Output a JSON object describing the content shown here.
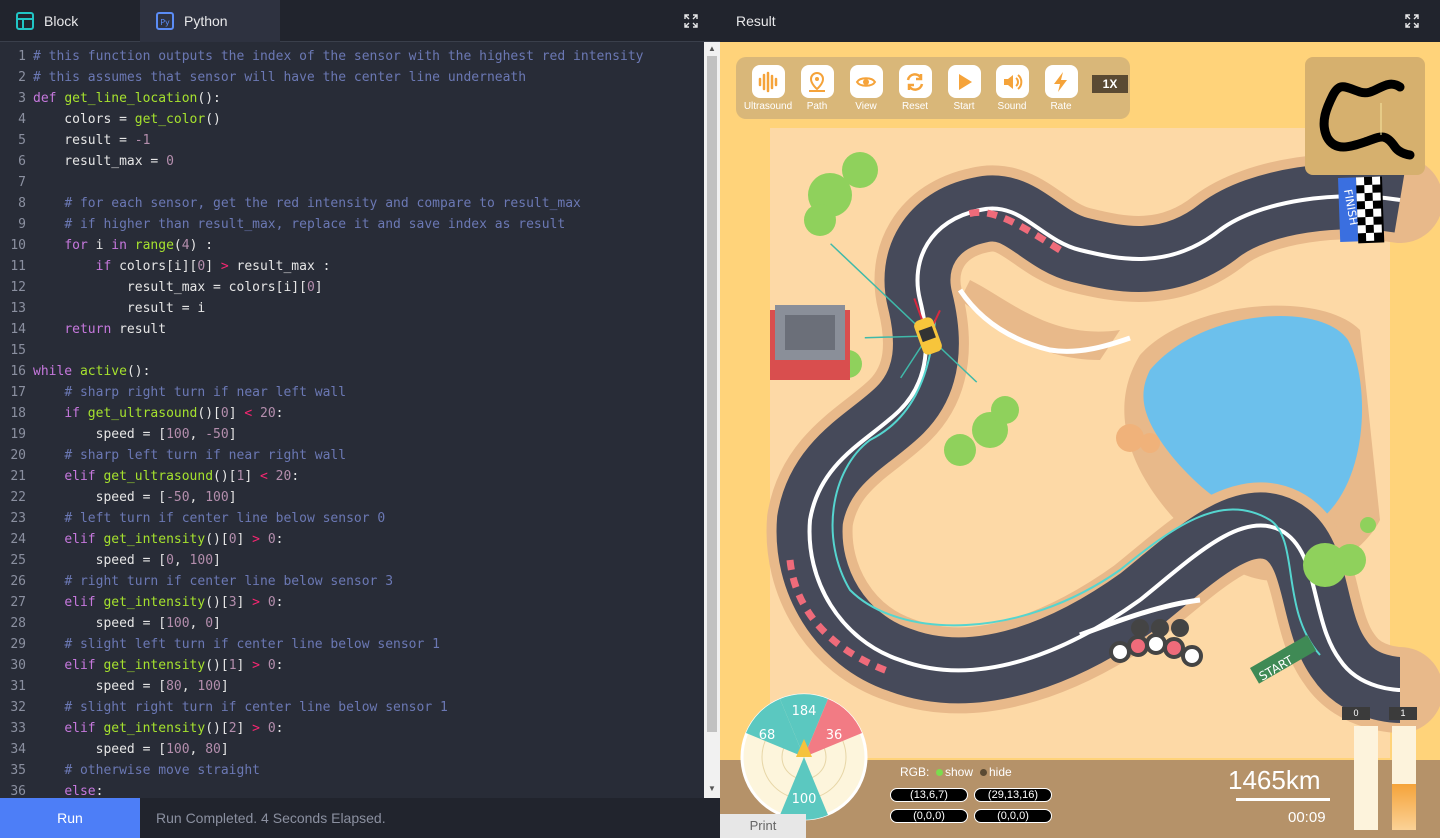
{
  "editor": {
    "tabs": [
      {
        "label": "Block",
        "icon": "block-grid-icon"
      },
      {
        "label": "Python",
        "icon": "python-file-icon"
      }
    ],
    "lines": [
      {
        "n": "1",
        "text": "# this function outputs the index of the sensor with the highest red intensity"
      },
      {
        "n": "2",
        "text": "# this assumes that sensor will have the center line underneath"
      },
      {
        "n": "3",
        "text": "def get_line_location():"
      },
      {
        "n": "4",
        "text": "    colors = get_color()"
      },
      {
        "n": "5",
        "text": "    result = -1"
      },
      {
        "n": "6",
        "text": "    result_max = 0"
      },
      {
        "n": "7",
        "text": ""
      },
      {
        "n": "8",
        "text": "    # for each sensor, get the red intensity and compare to result_max"
      },
      {
        "n": "9",
        "text": "    # if higher than result_max, replace it and save index as result"
      },
      {
        "n": "10",
        "text": "    for i in range(4) :"
      },
      {
        "n": "11",
        "text": "        if colors[i][0] > result_max :"
      },
      {
        "n": "12",
        "text": "            result_max = colors[i][0]"
      },
      {
        "n": "13",
        "text": "            result = i"
      },
      {
        "n": "14",
        "text": "    return result"
      },
      {
        "n": "15",
        "text": ""
      },
      {
        "n": "16",
        "text": "while active():"
      },
      {
        "n": "17",
        "text": "    # sharp right turn if near left wall"
      },
      {
        "n": "18",
        "text": "    if get_ultrasound()[0] < 20:"
      },
      {
        "n": "19",
        "text": "        speed = [100, -50]"
      },
      {
        "n": "20",
        "text": "    # sharp left turn if near right wall"
      },
      {
        "n": "21",
        "text": "    elif get_ultrasound()[1] < 20:"
      },
      {
        "n": "22",
        "text": "        speed = [-50, 100]"
      },
      {
        "n": "23",
        "text": "    # left turn if center line below sensor 0"
      },
      {
        "n": "24",
        "text": "    elif get_intensity()[0] > 0:"
      },
      {
        "n": "25",
        "text": "        speed = [0, 100]"
      },
      {
        "n": "26",
        "text": "    # right turn if center line below sensor 3"
      },
      {
        "n": "27",
        "text": "    elif get_intensity()[3] > 0:"
      },
      {
        "n": "28",
        "text": "        speed = [100, 0]"
      },
      {
        "n": "29",
        "text": "    # slight left turn if center line below sensor 1"
      },
      {
        "n": "30",
        "text": "    elif get_intensity()[1] > 0:"
      },
      {
        "n": "31",
        "text": "        speed = [80, 100]"
      },
      {
        "n": "32",
        "text": "    # slight right turn if center line below sensor 1"
      },
      {
        "n": "33",
        "text": "    elif get_intensity()[2] > 0:"
      },
      {
        "n": "34",
        "text": "        speed = [100, 80]"
      },
      {
        "n": "35",
        "text": "    # otherwise move straight"
      },
      {
        "n": "36",
        "text": "    else:"
      }
    ],
    "run_label": "Run",
    "status": "Run Completed. 4 Seconds Elapsed."
  },
  "result": {
    "title": "Result",
    "toolbar": [
      {
        "label": "Ultrasound",
        "icon": "soundwave-icon"
      },
      {
        "label": "Path",
        "icon": "path-pin-icon"
      },
      {
        "label": "View",
        "icon": "eye-icon"
      },
      {
        "label": "Reset",
        "icon": "refresh-icon"
      },
      {
        "label": "Start",
        "icon": "play-icon"
      },
      {
        "label": "Sound",
        "icon": "speaker-icon"
      },
      {
        "label": "Rate",
        "icon": "lightning-icon"
      }
    ],
    "rate": "1X",
    "track_labels": {
      "finish": "FINISH",
      "start": "START"
    },
    "compass": {
      "top": "184",
      "left": "68",
      "right": "36",
      "bottom": "100"
    },
    "rgb": {
      "label": "RGB:",
      "show": "show",
      "hide": "hide",
      "values": [
        "(13,6,7)",
        "(29,13,16)",
        "(0,0,0)",
        "(0,0,0)"
      ]
    },
    "distance": "1465km",
    "time": "00:09",
    "gauges": [
      {
        "label": "0",
        "level": 0
      },
      {
        "label": "1",
        "level": 1
      }
    ],
    "print_label": "Print",
    "colors": {
      "accent": "#f5a33a",
      "run": "#4d7ef7",
      "sand": "#ffd37a"
    }
  }
}
